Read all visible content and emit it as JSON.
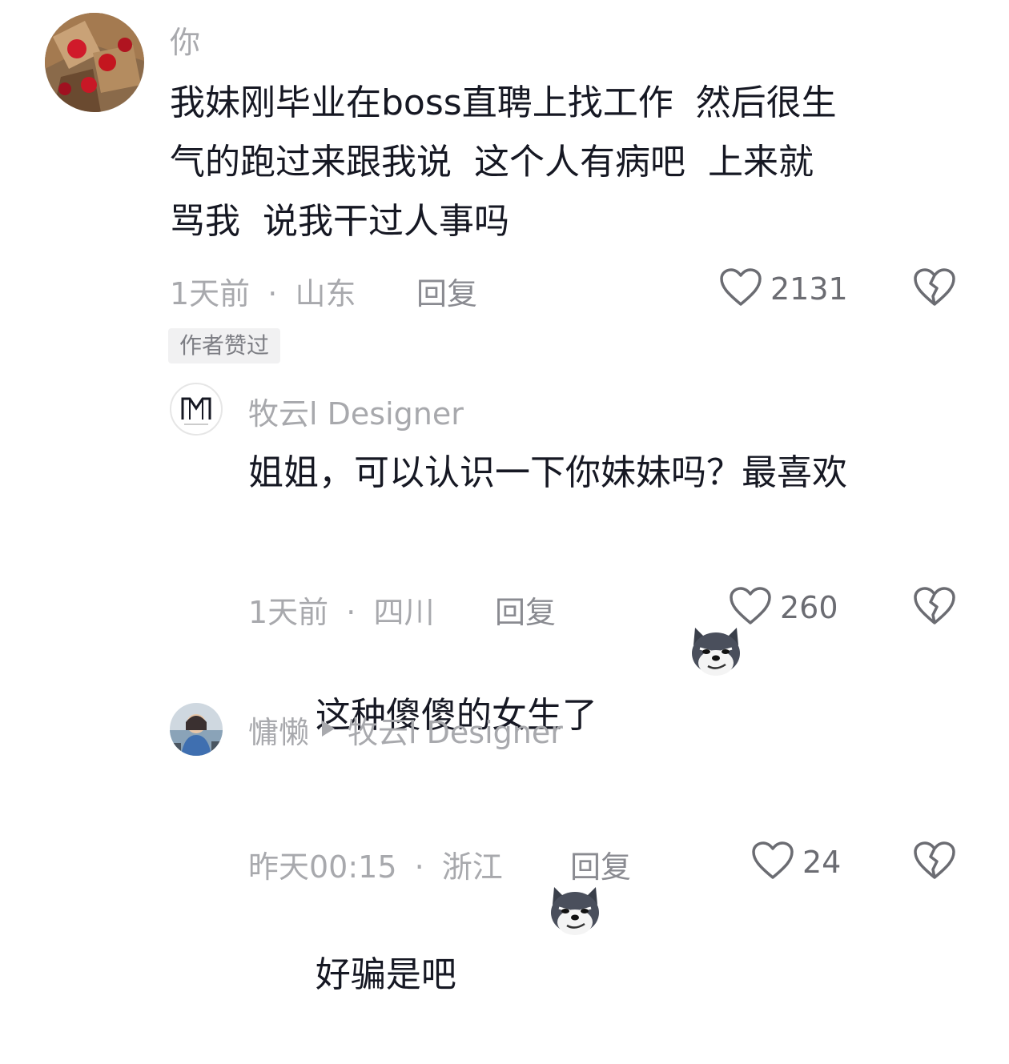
{
  "comments": [
    {
      "author": "你",
      "text_lines": [
        "我妹刚毕业在boss直聘上找工作  然后很生",
        "气的跑过来跟我说  这个人有病吧  上来就",
        "骂我  说我干过人事吗"
      ],
      "time": "1天前",
      "location": "山东",
      "reply_label": "回复",
      "likes": "2131",
      "badge": "作者赞过"
    },
    {
      "author": "牧云l Designer",
      "text_lines": [
        "姐姐，可以认识一下你妹妹吗？最喜欢",
        "这种傻傻的女生了"
      ],
      "time": "1天前",
      "location": "四川",
      "reply_label": "回复",
      "likes": "260"
    },
    {
      "author": "慵懒",
      "reply_to": "牧云l Designer",
      "text_lines": [
        "好骗是吧"
      ],
      "time": "昨天00:15",
      "location": "浙江",
      "reply_label": "回复",
      "likes": "24"
    }
  ],
  "separator": "·",
  "icons": {
    "like": "heart-outline-icon",
    "dislike": "broken-heart-icon",
    "emoji": "smirking-dog-emoji",
    "reply_arrow": "triangle-right-icon"
  },
  "colors": {
    "text": "#161823",
    "meta": "#a8a9ad",
    "badge_bg": "#f1f1f2"
  }
}
